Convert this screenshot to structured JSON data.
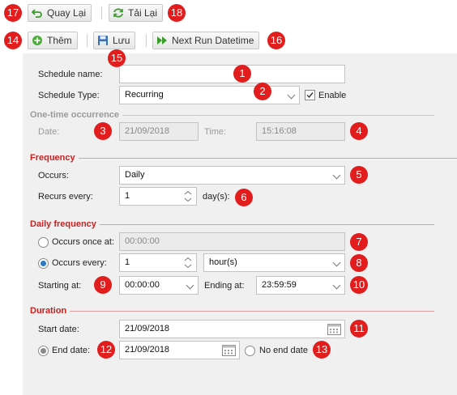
{
  "toolbar1": {
    "back_label": "Quay Lại",
    "reload_label": "Tải Lại"
  },
  "toolbar2": {
    "add_label": "Thêm",
    "save_label": "Lưu",
    "next_run_label": "Next Run Datetime"
  },
  "badges": [
    "1",
    "2",
    "3",
    "4",
    "5",
    "6",
    "7",
    "8",
    "9",
    "10",
    "11",
    "12",
    "13",
    "14",
    "15",
    "16",
    "17",
    "18"
  ],
  "form": {
    "schedule_name_label": "Schedule name:",
    "schedule_name_value": "",
    "schedule_type_label": "Schedule Type:",
    "schedule_type_value": "Recurring",
    "enable_label": "Enable",
    "enable_checked": true,
    "one_time_title": "One-time occurrence",
    "date_label": "Date:",
    "date_value": "21/09/2018",
    "time_label": "Time:",
    "time_value": "15:16:08",
    "frequency_title": "Frequency",
    "occurs_label": "Occurs:",
    "occurs_value": "Daily",
    "recurs_label": "Recurs every:",
    "recurs_value": "1",
    "recurs_unit": "day(s):",
    "daily_title": "Daily frequency",
    "once_at_label": "Occurs once at:",
    "once_at_value": "00:00:00",
    "every_label": "Occurs every:",
    "every_value": "1",
    "every_unit": "hour(s)",
    "starting_label": "Starting at:",
    "starting_value": "00:00:00",
    "ending_label": "Ending at:",
    "ending_value": "23:59:59",
    "duration_title": "Duration",
    "start_date_label": "Start date:",
    "start_date_value": "21/09/2018",
    "end_date_label": "End date:",
    "end_date_value": "21/09/2018",
    "no_end_label": "No end date"
  },
  "colors": {
    "badge": "#e11d1d",
    "section_red": "#cc1f1f",
    "radio_blue": "#2b78c4"
  }
}
